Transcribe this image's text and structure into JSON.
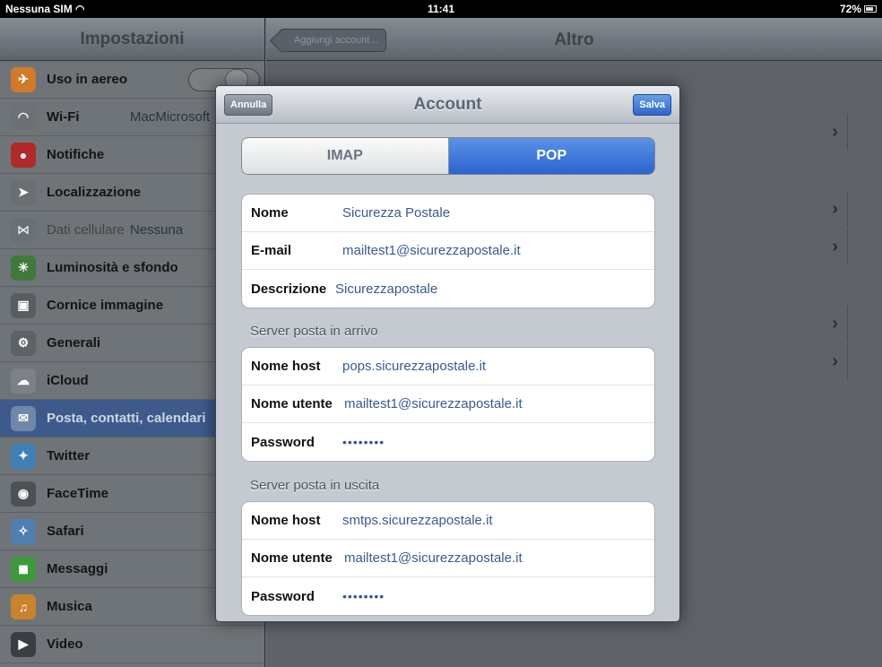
{
  "status_bar": {
    "carrier": "Nessuna SIM",
    "time": "11:41",
    "battery": "72%"
  },
  "sidebar": {
    "title": "Impostazioni",
    "items": [
      {
        "label": "Uso in aereo",
        "value": "",
        "icon": "airplane-icon",
        "color": "#d07a2a"
      },
      {
        "label": "Wi-Fi",
        "value": "MacMicrosoft",
        "icon": "wifi-icon",
        "color": "#6c7176"
      },
      {
        "label": "Notifiche",
        "value": "",
        "icon": "notifications-icon",
        "color": "#b02a2a"
      },
      {
        "label": "Localizzazione",
        "value": "",
        "icon": "location-icon",
        "color": "#6a6f73"
      },
      {
        "label": "Dati cellulare",
        "value": "Nessuna",
        "icon": "cellular-icon",
        "color": "#6a7078"
      },
      {
        "label": "Luminosità e sfondo",
        "value": "",
        "icon": "brightness-icon",
        "color": "#3f7a3a"
      },
      {
        "label": "Cornice immagine",
        "value": "",
        "icon": "picture-frame-icon",
        "color": "#585d62"
      },
      {
        "label": "Generali",
        "value": "",
        "icon": "gear-icon",
        "color": "#5d6266"
      },
      {
        "label": "iCloud",
        "value": "",
        "icon": "cloud-icon",
        "color": "#7b8186"
      },
      {
        "label": "Posta, contatti, calendari",
        "value": "",
        "icon": "mail-icon",
        "color": "#6f87a8"
      },
      {
        "label": "Twitter",
        "value": "",
        "icon": "twitter-icon",
        "color": "#3f7fb6"
      },
      {
        "label": "FaceTime",
        "value": "",
        "icon": "facetime-icon",
        "color": "#4c5156"
      },
      {
        "label": "Safari",
        "value": "",
        "icon": "safari-icon",
        "color": "#4f7fb0"
      },
      {
        "label": "Messaggi",
        "value": "",
        "icon": "messages-icon",
        "color": "#3c9a3c"
      },
      {
        "label": "Musica",
        "value": "",
        "icon": "music-icon",
        "color": "#c8832c"
      },
      {
        "label": "Video",
        "value": "",
        "icon": "video-icon",
        "color": "#3a3e42"
      }
    ]
  },
  "main": {
    "title": "Altro",
    "back_label": "Aggiungi account..."
  },
  "modal": {
    "title": "Account",
    "cancel_label": "Annulla",
    "save_label": "Salva",
    "segments": {
      "imap": "IMAP",
      "pop": "POP",
      "selected": "POP"
    },
    "account": {
      "name_label": "Nome",
      "name_value": "Sicurezza Postale",
      "email_label": "E-mail",
      "email_value": "mailtest1@sicurezzapostale.it",
      "desc_label": "Descrizione",
      "desc_value": "Sicurezzapostale"
    },
    "incoming": {
      "header": "Server posta in arrivo",
      "host_label": "Nome host",
      "host_value": "pops.sicurezzapostale.it",
      "user_label": "Nome utente",
      "user_value": "mailtest1@sicurezzapostale.it",
      "pass_label": "Password",
      "pass_value": "••••••••"
    },
    "outgoing": {
      "header": "Server posta in uscita",
      "host_label": "Nome host",
      "host_value": "smtps.sicurezzapostale.it",
      "user_label": "Nome utente",
      "user_value": "mailtest1@sicurezzapostale.it",
      "pass_label": "Password",
      "pass_value": "••••••••"
    }
  }
}
